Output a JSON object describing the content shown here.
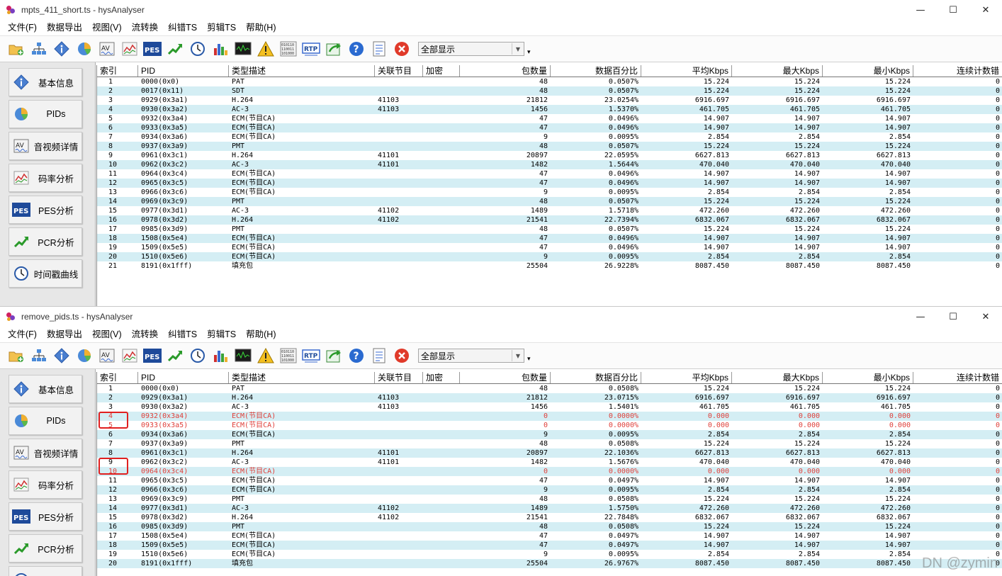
{
  "accent_removed": "#e0403a",
  "row_alt_color": "#d4eef4",
  "menu": [
    {
      "label": "文件(F)"
    },
    {
      "label": "数据导出"
    },
    {
      "label": "视图(V)"
    },
    {
      "label": "流转换"
    },
    {
      "label": "纠错TS"
    },
    {
      "label": "剪辑TS"
    },
    {
      "label": "帮助(H)"
    }
  ],
  "toolbar": {
    "icons": [
      "open-folder-add-icon",
      "network-tree-icon",
      "info-icon",
      "pie-chart-icon",
      "av-icon",
      "bitrate-line-icon",
      "pes-icon",
      "pcr-trend-icon",
      "clock-icon",
      "bar-chart-icon",
      "oscilloscope-icon",
      "warning-icon",
      "binary-data-icon",
      "rtp-icon",
      "export-arrow-icon",
      "help-icon",
      "list-report-icon",
      "close-red-icon"
    ],
    "filter_value": "全部显示",
    "more": "▾"
  },
  "sidebar": [
    {
      "label": "基本信息",
      "icon": "info-icon"
    },
    {
      "label": "PIDs",
      "icon": "pie-chart-icon"
    },
    {
      "label": "音视频详情",
      "icon": "av-icon"
    },
    {
      "label": "码率分析",
      "icon": "bitrate-line-icon"
    },
    {
      "label": "PES分析",
      "icon": "pes-icon"
    },
    {
      "label": "PCR分析",
      "icon": "pcr-trend-icon"
    },
    {
      "label": "时间戳曲线",
      "icon": "clock-icon"
    }
  ],
  "columns": [
    "索引",
    "PID",
    "类型描述",
    "关联节目",
    "加密",
    "包数量",
    "数据百分比",
    "平均Kbps",
    "最大Kbps",
    "最小Kbps",
    "连续计数错"
  ],
  "window1": {
    "title": "mpts_411_short.ts - hysAnalyser",
    "rows": [
      [
        "1",
        "0000(0x0)",
        "PAT",
        "",
        "",
        "48",
        "0.0507%",
        "15.224",
        "15.224",
        "15.224",
        "0"
      ],
      [
        "2",
        "0017(0x11)",
        "SDT",
        "",
        "",
        "48",
        "0.0507%",
        "15.224",
        "15.224",
        "15.224",
        "0"
      ],
      [
        "3",
        "0929(0x3a1)",
        "H.264",
        "41103",
        "",
        "21812",
        "23.0254%",
        "6916.697",
        "6916.697",
        "6916.697",
        "0"
      ],
      [
        "4",
        "0930(0x3a2)",
        "AC-3",
        "41103",
        "",
        "1456",
        "1.5370%",
        "461.705",
        "461.705",
        "461.705",
        "0"
      ],
      [
        "5",
        "0932(0x3a4)",
        "ECM(节目CA)",
        "",
        "",
        "47",
        "0.0496%",
        "14.907",
        "14.907",
        "14.907",
        "0"
      ],
      [
        "6",
        "0933(0x3a5)",
        "ECM(节目CA)",
        "",
        "",
        "47",
        "0.0496%",
        "14.907",
        "14.907",
        "14.907",
        "0"
      ],
      [
        "7",
        "0934(0x3a6)",
        "ECM(节目CA)",
        "",
        "",
        "9",
        "0.0095%",
        "2.854",
        "2.854",
        "2.854",
        "0"
      ],
      [
        "8",
        "0937(0x3a9)",
        "PMT",
        "",
        "",
        "48",
        "0.0507%",
        "15.224",
        "15.224",
        "15.224",
        "0"
      ],
      [
        "9",
        "0961(0x3c1)",
        "H.264",
        "41101",
        "",
        "20897",
        "22.0595%",
        "6627.813",
        "6627.813",
        "6627.813",
        "0"
      ],
      [
        "10",
        "0962(0x3c2)",
        "AC-3",
        "41101",
        "",
        "1482",
        "1.5644%",
        "470.040",
        "470.040",
        "470.040",
        "0"
      ],
      [
        "11",
        "0964(0x3c4)",
        "ECM(节目CA)",
        "",
        "",
        "47",
        "0.0496%",
        "14.907",
        "14.907",
        "14.907",
        "0"
      ],
      [
        "12",
        "0965(0x3c5)",
        "ECM(节目CA)",
        "",
        "",
        "47",
        "0.0496%",
        "14.907",
        "14.907",
        "14.907",
        "0"
      ],
      [
        "13",
        "0966(0x3c6)",
        "ECM(节目CA)",
        "",
        "",
        "9",
        "0.0095%",
        "2.854",
        "2.854",
        "2.854",
        "0"
      ],
      [
        "14",
        "0969(0x3c9)",
        "PMT",
        "",
        "",
        "48",
        "0.0507%",
        "15.224",
        "15.224",
        "15.224",
        "0"
      ],
      [
        "15",
        "0977(0x3d1)",
        "AC-3",
        "41102",
        "",
        "1489",
        "1.5718%",
        "472.260",
        "472.260",
        "472.260",
        "0"
      ],
      [
        "16",
        "0978(0x3d2)",
        "H.264",
        "41102",
        "",
        "21541",
        "22.7394%",
        "6832.067",
        "6832.067",
        "6832.067",
        "0"
      ],
      [
        "17",
        "0985(0x3d9)",
        "PMT",
        "",
        "",
        "48",
        "0.0507%",
        "15.224",
        "15.224",
        "15.224",
        "0"
      ],
      [
        "18",
        "1508(0x5e4)",
        "ECM(节目CA)",
        "",
        "",
        "47",
        "0.0496%",
        "14.907",
        "14.907",
        "14.907",
        "0"
      ],
      [
        "19",
        "1509(0x5e5)",
        "ECM(节目CA)",
        "",
        "",
        "47",
        "0.0496%",
        "14.907",
        "14.907",
        "14.907",
        "0"
      ],
      [
        "20",
        "1510(0x5e6)",
        "ECM(节目CA)",
        "",
        "",
        "9",
        "0.0095%",
        "2.854",
        "2.854",
        "2.854",
        "0"
      ],
      [
        "21",
        "8191(0x1fff)",
        "填充包",
        "",
        "",
        "25504",
        "26.9228%",
        "8087.450",
        "8087.450",
        "8087.450",
        "0"
      ]
    ]
  },
  "window2": {
    "title": "remove_pids.ts - hysAnalyser",
    "removed_rows": [
      4,
      5,
      10
    ],
    "rows": [
      [
        "1",
        "0000(0x0)",
        "PAT",
        "",
        "",
        "48",
        "0.0508%",
        "15.224",
        "15.224",
        "15.224",
        "0"
      ],
      [
        "2",
        "0929(0x3a1)",
        "H.264",
        "41103",
        "",
        "21812",
        "23.0715%",
        "6916.697",
        "6916.697",
        "6916.697",
        "0"
      ],
      [
        "3",
        "0930(0x3a2)",
        "AC-3",
        "41103",
        "",
        "1456",
        "1.5401%",
        "461.705",
        "461.705",
        "461.705",
        "0"
      ],
      [
        "4",
        "0932(0x3a4)",
        "ECM(节目CA)",
        "",
        "",
        "0",
        "0.0000%",
        "0.000",
        "0.000",
        "0.000",
        "0"
      ],
      [
        "5",
        "0933(0x3a5)",
        "ECM(节目CA)",
        "",
        "",
        "0",
        "0.0000%",
        "0.000",
        "0.000",
        "0.000",
        "0"
      ],
      [
        "6",
        "0934(0x3a6)",
        "ECM(节目CA)",
        "",
        "",
        "9",
        "0.0095%",
        "2.854",
        "2.854",
        "2.854",
        "0"
      ],
      [
        "7",
        "0937(0x3a9)",
        "PMT",
        "",
        "",
        "48",
        "0.0508%",
        "15.224",
        "15.224",
        "15.224",
        "0"
      ],
      [
        "8",
        "0961(0x3c1)",
        "H.264",
        "41101",
        "",
        "20897",
        "22.1036%",
        "6627.813",
        "6627.813",
        "6627.813",
        "0"
      ],
      [
        "9",
        "0962(0x3c2)",
        "AC-3",
        "41101",
        "",
        "1482",
        "1.5676%",
        "470.040",
        "470.040",
        "470.040",
        "0"
      ],
      [
        "10",
        "0964(0x3c4)",
        "ECM(节目CA)",
        "",
        "",
        "0",
        "0.0000%",
        "0.000",
        "0.000",
        "0.000",
        "0"
      ],
      [
        "11",
        "0965(0x3c5)",
        "ECM(节目CA)",
        "",
        "",
        "47",
        "0.0497%",
        "14.907",
        "14.907",
        "14.907",
        "0"
      ],
      [
        "12",
        "0966(0x3c6)",
        "ECM(节目CA)",
        "",
        "",
        "9",
        "0.0095%",
        "2.854",
        "2.854",
        "2.854",
        "0"
      ],
      [
        "13",
        "0969(0x3c9)",
        "PMT",
        "",
        "",
        "48",
        "0.0508%",
        "15.224",
        "15.224",
        "15.224",
        "0"
      ],
      [
        "14",
        "0977(0x3d1)",
        "AC-3",
        "41102",
        "",
        "1489",
        "1.5750%",
        "472.260",
        "472.260",
        "472.260",
        "0"
      ],
      [
        "15",
        "0978(0x3d2)",
        "H.264",
        "41102",
        "",
        "21541",
        "22.7848%",
        "6832.067",
        "6832.067",
        "6832.067",
        "0"
      ],
      [
        "16",
        "0985(0x3d9)",
        "PMT",
        "",
        "",
        "48",
        "0.0508%",
        "15.224",
        "15.224",
        "15.224",
        "0"
      ],
      [
        "17",
        "1508(0x5e4)",
        "ECM(节目CA)",
        "",
        "",
        "47",
        "0.0497%",
        "14.907",
        "14.907",
        "14.907",
        "0"
      ],
      [
        "18",
        "1509(0x5e5)",
        "ECM(节目CA)",
        "",
        "",
        "47",
        "0.0497%",
        "14.907",
        "14.907",
        "14.907",
        "0"
      ],
      [
        "19",
        "1510(0x5e6)",
        "ECM(节目CA)",
        "",
        "",
        "9",
        "0.0095%",
        "2.854",
        "2.854",
        "2.854",
        "0"
      ],
      [
        "20",
        "8191(0x1fff)",
        "填充包",
        "",
        "",
        "25504",
        "26.9767%",
        "8087.450",
        "8087.450",
        "8087.450",
        "0"
      ]
    ]
  },
  "window_controls": {
    "minimize": "—",
    "maximize": "☐",
    "close": "✕"
  },
  "watermark": "DN @zymin"
}
